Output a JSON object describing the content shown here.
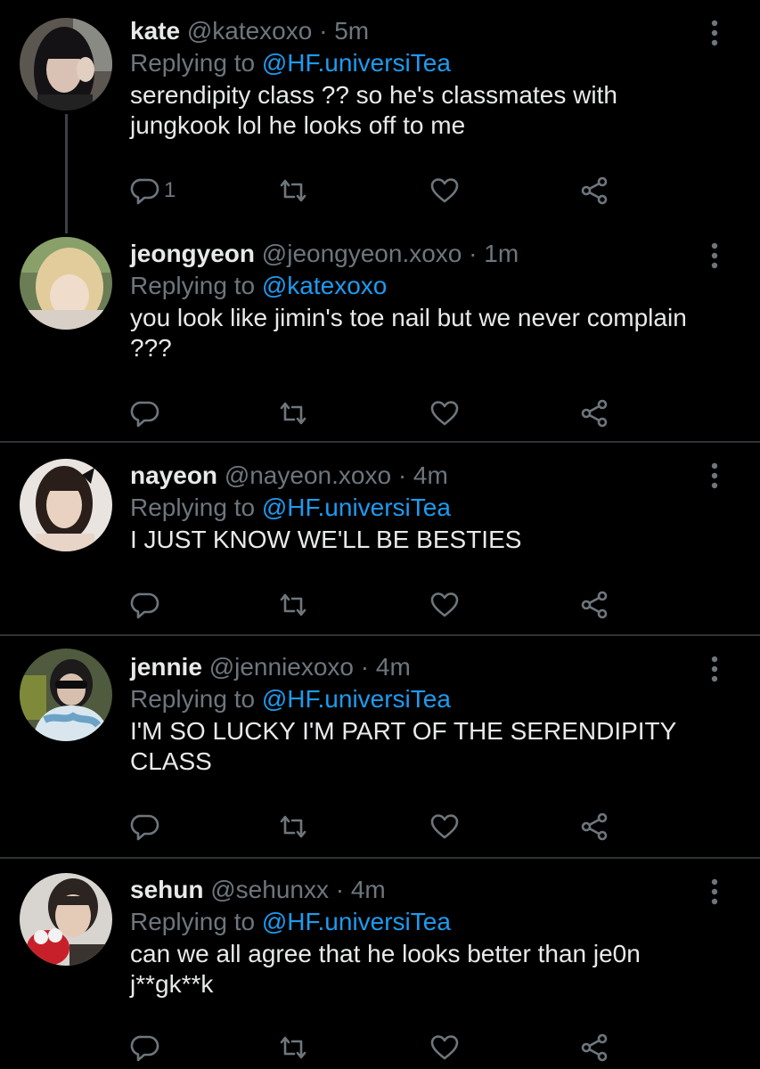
{
  "tweets": [
    {
      "name": "kate",
      "handle": "@katexoxo",
      "dot": "·",
      "time": "5m",
      "replying_prefix": "Replying to ",
      "replying_to": "@HF.universiTea",
      "text": "serendipity class ?? so he's classmates with jungkook lol he looks off to me",
      "reply_count": "1"
    },
    {
      "name": "jeongyeon",
      "handle": "@jeongyeon.xoxo",
      "dot": "·",
      "time": "1m",
      "replying_prefix": "Replying to ",
      "replying_to": "@katexoxo",
      "text": "you look like jimin's toe nail but we never complain ???",
      "reply_count": ""
    },
    {
      "name": "nayeon",
      "handle": "@nayeon.xoxo",
      "dot": "·",
      "time": "4m",
      "replying_prefix": "Replying to ",
      "replying_to": "@HF.universiTea",
      "text": "I JUST KNOW WE'LL BE BESTIES",
      "reply_count": ""
    },
    {
      "name": "jennie",
      "handle": "@jenniexoxo",
      "dot": "·",
      "time": "4m",
      "replying_prefix": "Replying to ",
      "replying_to": "@HF.universiTea",
      "text": "I'M SO LUCKY I'M PART OF THE SERENDIPITY CLASS",
      "reply_count": ""
    },
    {
      "name": "sehun",
      "handle": "@sehunxx",
      "dot": "·",
      "time": "4m",
      "replying_prefix": "Replying to ",
      "replying_to": "@HF.universiTea",
      "text": "can we all agree that he looks better than je0n j**gk**k",
      "reply_count": ""
    }
  ],
  "icons": {
    "reply": "reply-icon",
    "retweet": "retweet-icon",
    "like": "heart-icon",
    "share": "share-icon",
    "more": "more-vertical-icon"
  },
  "colors": {
    "background": "#000000",
    "name": "#e7e9ea",
    "muted": "#6e767d",
    "mention": "#1d9bf0",
    "divider": "#2f3336"
  }
}
